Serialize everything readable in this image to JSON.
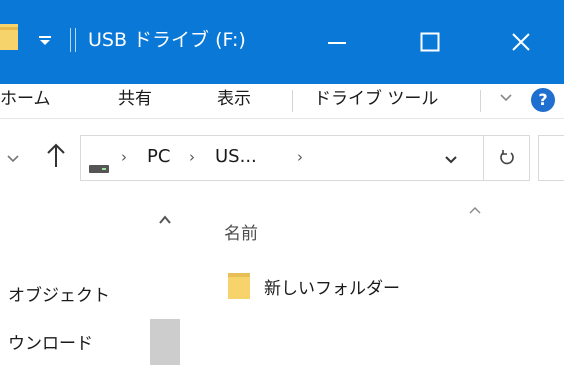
{
  "window": {
    "title": "USB ドライブ (F:)",
    "controls": {
      "minimize": "—",
      "maximize": "☐",
      "close": "✕"
    }
  },
  "ribbon": {
    "tabs": [
      "ホーム",
      "共有",
      "表示",
      "ドライブ ツール"
    ],
    "help": "?"
  },
  "address_bar": {
    "crumbs": [
      "PC",
      "US..."
    ],
    "separator": "›"
  },
  "navigation_pane": {
    "items": [
      "オブジェクト",
      "ウンロード"
    ]
  },
  "content": {
    "column_header": "名前",
    "items": [
      {
        "name": "新しいフォルダー",
        "icon": "folder-icon"
      }
    ]
  },
  "colors": {
    "titlebar": "#0a78d7",
    "folder": "#f7d36b",
    "help": "#1f6fd0"
  }
}
